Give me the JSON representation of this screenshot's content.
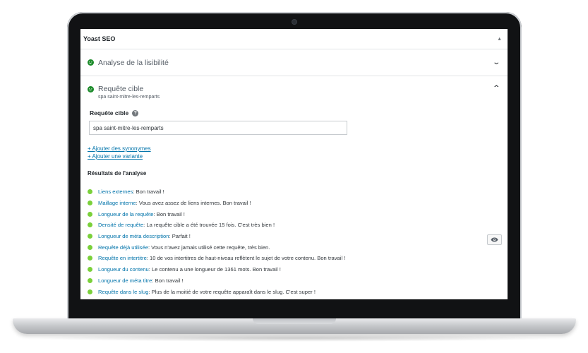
{
  "panel": {
    "title": "Yoast SEO",
    "collapse_arrow": "▲"
  },
  "readability": {
    "title": "Analyse de la lisibilité",
    "chevron": "⌄"
  },
  "keyphrase": {
    "title": "Requête cible",
    "subtitle": "spa saint-mitre-les-remparts",
    "chevron": "⌃",
    "field_label": "Requête cible",
    "help": "?",
    "input_value": "spa saint-mitre-les-remparts",
    "add_synonyms": "+ Ajouter des synonymes",
    "add_variant": "+ Ajouter une variante",
    "results_title": "Résultats de l'analyse"
  },
  "results": [
    {
      "label": "Liens externes",
      "text": " : Bon travail !"
    },
    {
      "label": "Maillage interne",
      "text": " : Vous avez assez de liens internes. Bon travail !"
    },
    {
      "label": "Longueur de la requête",
      "text": " : Bon travail !"
    },
    {
      "label": "Densité de requête",
      "text": " : La requête cible a été trouvée 15 fois. C'est très bien !"
    },
    {
      "label": "Longueur de méta description",
      "text": " : Parfait !"
    },
    {
      "label": "Requête déjà utilisée",
      "text": " : Vous n'avez jamais utilisé cette requête, très bien."
    },
    {
      "label": "Requête en intertitre",
      "text": " : 10 de vos intertitres de haut-niveau reflètent le sujet de votre contenu. Bon travail !"
    },
    {
      "label": "Longueur du contenu",
      "text": " : Le contenu a une longueur de 1361 mots. Bon travail !"
    },
    {
      "label": "Longueur de méta titre",
      "text": " : Bon travail !"
    },
    {
      "label": "Requête dans le slug",
      "text": " : Plus de la moitié de votre requête apparaît dans le slug. C'est super !"
    }
  ],
  "colors": {
    "good": "#7ad03a",
    "smiley": "#1e8c2c",
    "link": "#0073aa"
  },
  "icons": {
    "eye": "eye-icon",
    "smiley": "smiley-good-icon"
  }
}
